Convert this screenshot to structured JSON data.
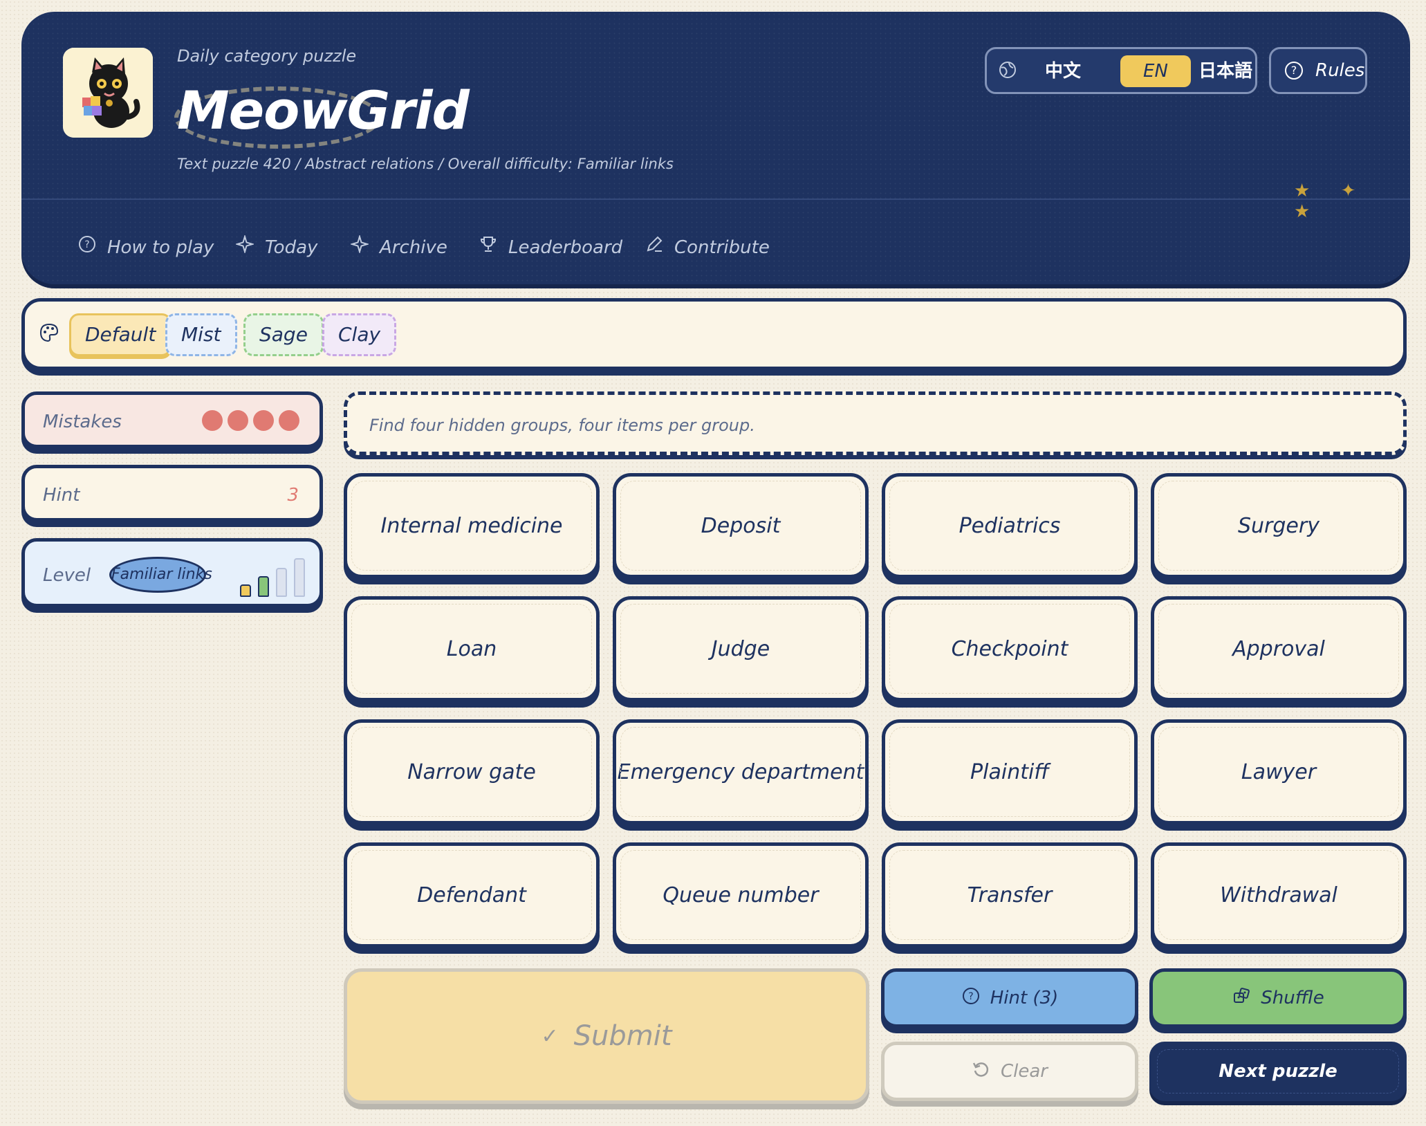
{
  "header": {
    "kicker": "Daily category puzzle",
    "brand": "MeowGrid",
    "subtitle": "Text puzzle 420 / Abstract relations / Overall difficulty: Familiar links",
    "languages": [
      "中文",
      "EN",
      "日本語"
    ],
    "active_language": "EN",
    "rules_label": "Rules",
    "stars": "★ ✦ ★"
  },
  "nav": {
    "items": [
      {
        "label": "How to play",
        "icon": "help-circle-icon"
      },
      {
        "label": "Today",
        "icon": "sparkle-icon"
      },
      {
        "label": "Archive",
        "icon": "sparkle-icon"
      },
      {
        "label": "Leaderboard",
        "icon": "trophy-icon"
      },
      {
        "label": "Contribute",
        "icon": "pencil-icon"
      }
    ]
  },
  "themes": {
    "items": [
      "Default",
      "Mist",
      "Sage",
      "Clay"
    ],
    "selected": "Default"
  },
  "stats": {
    "mistakes_label": "Mistakes",
    "mistakes_remaining": 4,
    "hint_label": "Hint",
    "hint_count": "3",
    "level_label": "Level",
    "level_value": "Familiar links",
    "level_bars_filled": 2,
    "level_bars_total": 4
  },
  "prompt": "Find four hidden groups, four items per group.",
  "tiles": [
    "Internal medicine",
    "Deposit",
    "Pediatrics",
    "Surgery",
    "Loan",
    "Judge",
    "Checkpoint",
    "Approval",
    "Narrow gate",
    "Emergency department",
    "Plaintiff",
    "Lawyer",
    "Defendant",
    "Queue number",
    "Transfer",
    "Withdrawal"
  ],
  "actions": {
    "submit": "Submit",
    "hint": "Hint (3)",
    "shuffle": "Shuffle",
    "clear": "Clear",
    "next": "Next puzzle"
  },
  "colors": {
    "navy": "#1e3260",
    "cream": "#fbf5e7",
    "accent_yellow": "#f0c95c",
    "mistake_dot": "#e07a72",
    "hint_blue": "#7eb2e4",
    "shuffle_green": "#88c57a"
  }
}
